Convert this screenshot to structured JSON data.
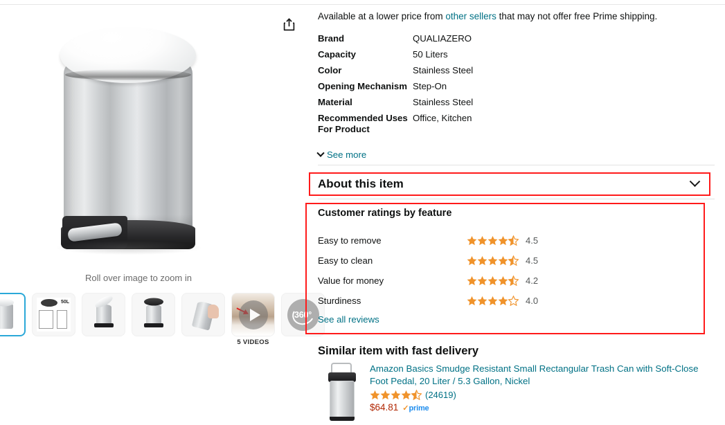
{
  "hero": {
    "rollover_note": "Roll over image to zoom in",
    "product_alt": "QUALIAZERO 50 Liter stainless steel step-on trash can",
    "share_icon": "share-icon"
  },
  "thumbnails": [
    {
      "id": "thumb-main",
      "type": "photo",
      "selected": true,
      "label": ""
    },
    {
      "id": "thumb-dimensions",
      "type": "diagram",
      "selected": false,
      "label": "50L"
    },
    {
      "id": "thumb-open-lid",
      "type": "photo",
      "selected": false,
      "label": ""
    },
    {
      "id": "thumb-liner",
      "type": "photo",
      "selected": false,
      "label": ""
    },
    {
      "id": "thumb-hand-open",
      "type": "photo",
      "selected": false,
      "label": ""
    },
    {
      "id": "thumb-video",
      "type": "video",
      "selected": false,
      "label": "5 VIDEOS"
    },
    {
      "id": "thumb-360",
      "type": "spin",
      "selected": false,
      "label": "360°"
    }
  ],
  "offer_note": {
    "prefix": "Available at a lower price from ",
    "link": "other sellers",
    "suffix": " that may not offer free Prime shipping."
  },
  "specs": [
    {
      "key": "Brand",
      "value": "QUALIAZERO"
    },
    {
      "key": "Capacity",
      "value": "50 Liters"
    },
    {
      "key": "Color",
      "value": "Stainless Steel"
    },
    {
      "key": "Opening Mechanism",
      "value": "Step-On"
    },
    {
      "key": "Material",
      "value": "Stainless Steel"
    },
    {
      "key": "Recommended Uses For Product",
      "value": "Office, Kitchen"
    }
  ],
  "spec_key_wrapped": {
    "line1": "Recommended Uses",
    "line2": "For Product"
  },
  "see_more": {
    "label": "See more",
    "icon": "chevron-down-icon"
  },
  "about": {
    "title": "About this item",
    "expand_icon": "chevron-down-icon",
    "highlighted": true
  },
  "ratings_by_feature": {
    "title": "Customer ratings by feature",
    "highlighted": true,
    "rows": [
      {
        "label": "Easy to remove",
        "score": "4.5",
        "value": 4.5
      },
      {
        "label": "Easy to clean",
        "score": "4.5",
        "value": 4.5
      },
      {
        "label": "Value for money",
        "score": "4.2",
        "value": 4.2
      },
      {
        "label": "Sturdiness",
        "score": "4.0",
        "value": 4.0
      }
    ],
    "see_all_reviews": "See all reviews"
  },
  "similar_item": {
    "section_title": "Similar item with fast delivery",
    "title": "Amazon Basics Smudge Resistant Small Rectangular Trash Can with Soft-Close Foot Pedal, 20 Liter / 5.3 Gallon, Nickel",
    "rating_value": 4.6,
    "review_count": "(24619)",
    "price": "$64.81",
    "prime_label": "prime",
    "prime_check": "✓"
  },
  "colors": {
    "link": "#007185",
    "price": "#b12704",
    "star": "#f0932b",
    "annotation": "#ff1a1a",
    "prime_blue": "#1f8ded",
    "selected_thumb_border": "#2aa8d8",
    "text": "#0f1111",
    "muted": "#565959"
  }
}
